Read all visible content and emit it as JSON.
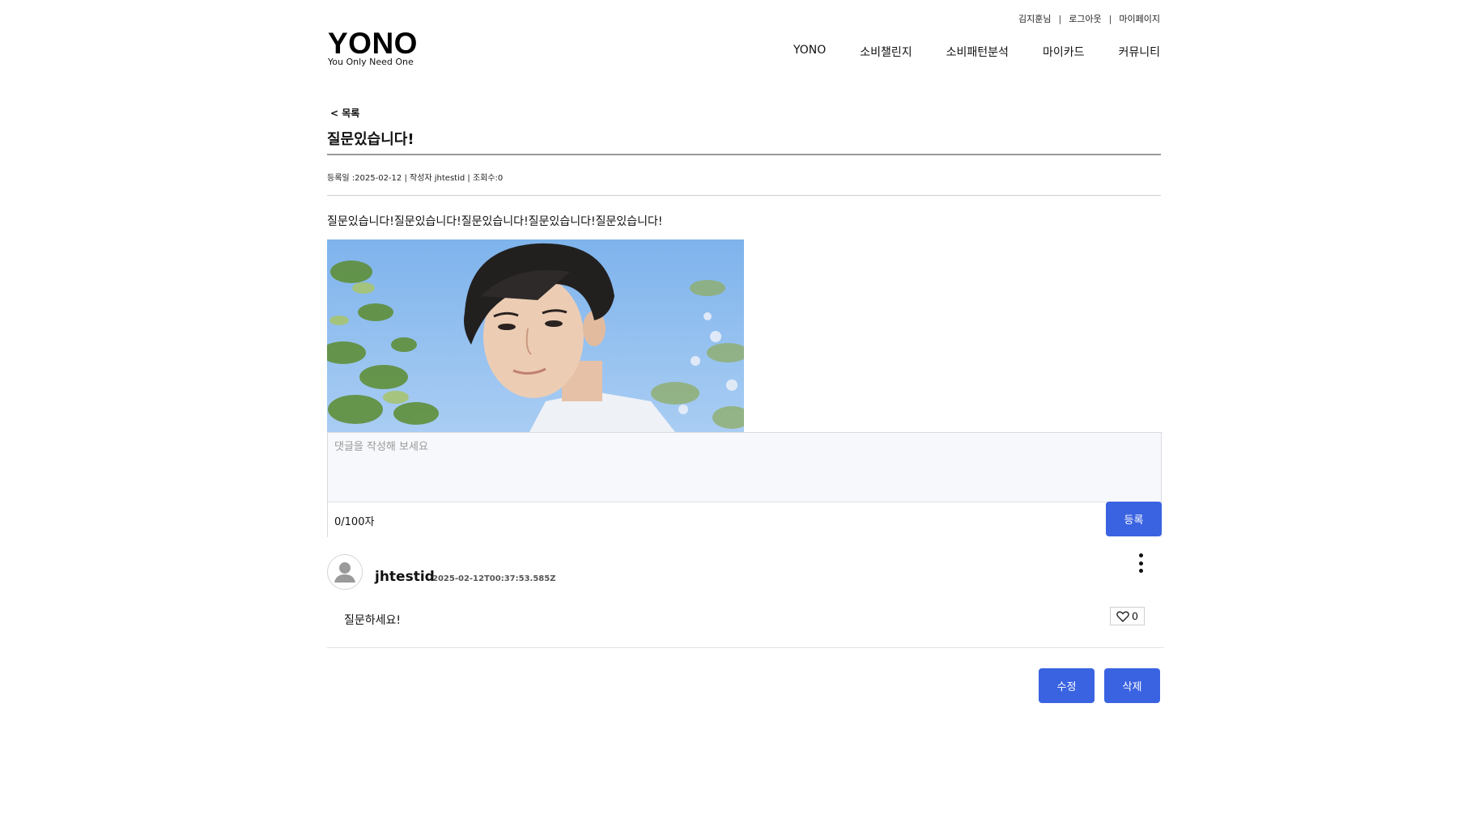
{
  "util_links": {
    "user": "김지훈님",
    "logout": "로그아웃",
    "mypage": "마이페이지",
    "separator": "|"
  },
  "logo": {
    "main": "YONO",
    "sub": "You Only Need One"
  },
  "nav": [
    "YONO",
    "소비챌린지",
    "소비패턴분석",
    "마이카드",
    "커뮤니티"
  ],
  "post": {
    "back_label": "< 목록",
    "title": "질문있습니다!",
    "meta": "등록일 :2025-02-12 | 작성자 jhtestid | 조회수:0",
    "body": "질문있습니다!질문있습니다!질문있습니다!질문있습니다!질문있습니다!"
  },
  "comment_form": {
    "placeholder": "댓글을 작성해 보세요",
    "counter": "0/100자",
    "submit_label": "등록"
  },
  "comments": [
    {
      "author": "jhtestid",
      "date": "2025-02-12T00:37:53.585Z",
      "text": "질문하세요!",
      "likes": "0"
    }
  ],
  "actions": {
    "edit_label": "수정",
    "delete_label": "삭제"
  },
  "colors": {
    "accent": "#3a63e2",
    "divider": "#cfcfcf"
  }
}
